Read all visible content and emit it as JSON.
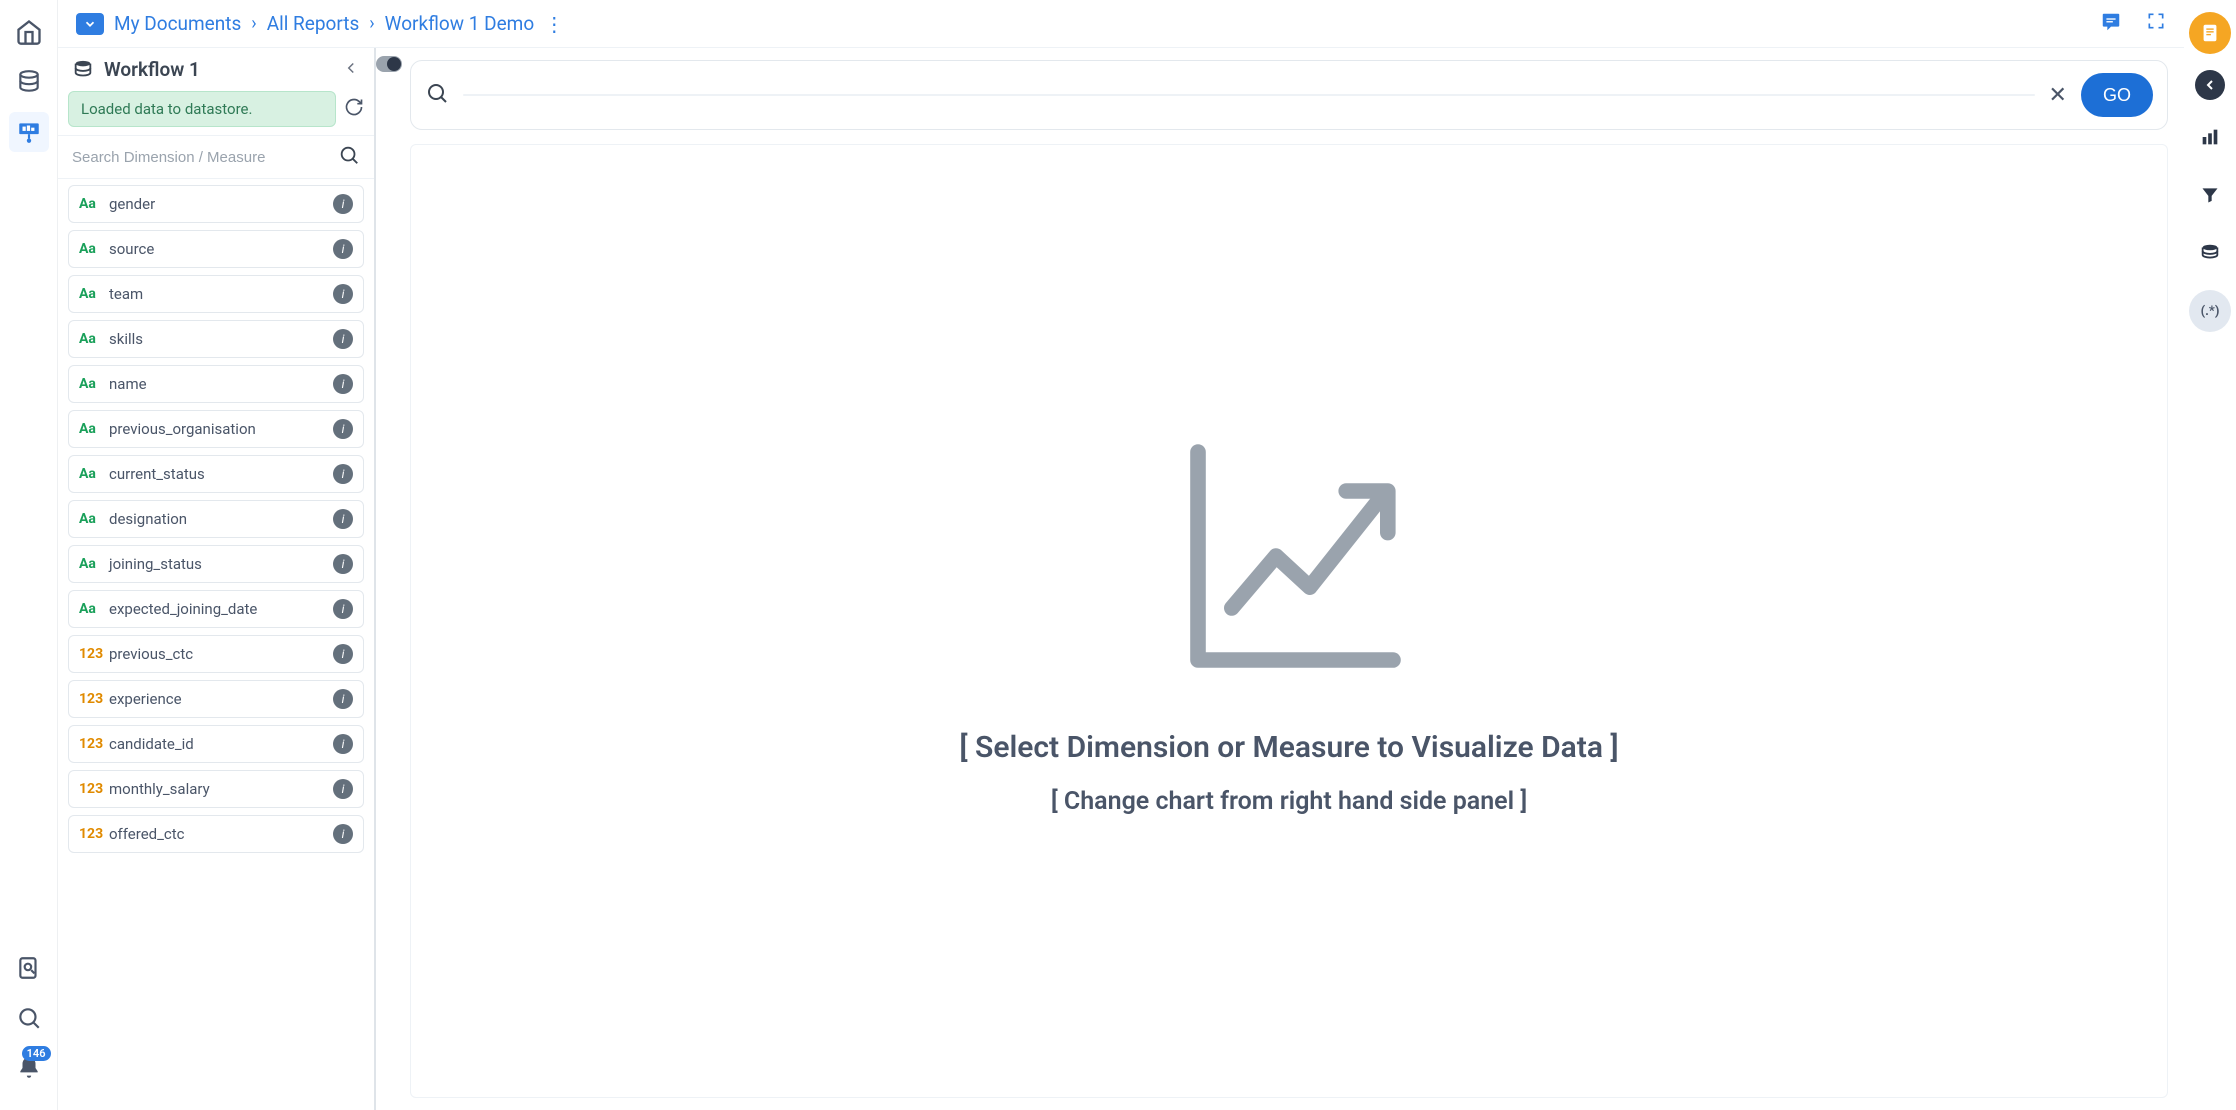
{
  "breadcrumb": {
    "items": [
      "My Documents",
      "All Reports",
      "Workflow 1 Demo"
    ]
  },
  "left_rail": {
    "notifications_count": "146"
  },
  "field_panel": {
    "title": "Workflow 1",
    "status_message": "Loaded data to datastore.",
    "search_placeholder": "Search Dimension / Measure",
    "fields": [
      {
        "type": "Aa",
        "kind": "dim",
        "name": "gender"
      },
      {
        "type": "Aa",
        "kind": "dim",
        "name": "source"
      },
      {
        "type": "Aa",
        "kind": "dim",
        "name": "team"
      },
      {
        "type": "Aa",
        "kind": "dim",
        "name": "skills"
      },
      {
        "type": "Aa",
        "kind": "dim",
        "name": "name"
      },
      {
        "type": "Aa",
        "kind": "dim",
        "name": "previous_organisation"
      },
      {
        "type": "Aa",
        "kind": "dim",
        "name": "current_status"
      },
      {
        "type": "Aa",
        "kind": "dim",
        "name": "designation"
      },
      {
        "type": "Aa",
        "kind": "dim",
        "name": "joining_status"
      },
      {
        "type": "Aa",
        "kind": "dim",
        "name": "expected_joining_date"
      },
      {
        "type": "123",
        "kind": "meas",
        "name": "previous_ctc"
      },
      {
        "type": "123",
        "kind": "meas",
        "name": "experience"
      },
      {
        "type": "123",
        "kind": "meas",
        "name": "candidate_id"
      },
      {
        "type": "123",
        "kind": "meas",
        "name": "monthly_salary"
      },
      {
        "type": "123",
        "kind": "meas",
        "name": "offered_ctc"
      }
    ]
  },
  "search_bar": {
    "go_label": "GO"
  },
  "placeholder": {
    "line1": "[ Select Dimension or Measure to Visualize Data ]",
    "line2": "[ Change chart from right hand side panel ]"
  }
}
